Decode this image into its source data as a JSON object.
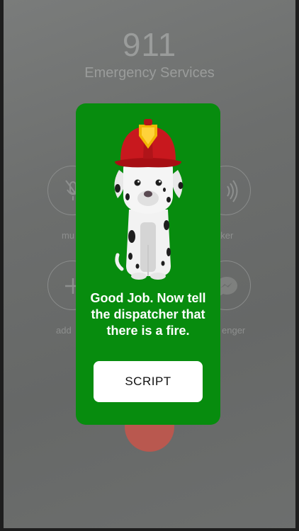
{
  "call": {
    "number": "911",
    "name": "Emergency Services",
    "buttons": {
      "mute": "mu",
      "speaker": "aker",
      "add": "add",
      "messenger": "enger"
    }
  },
  "modal": {
    "message": "Good Job. Now tell the dispatcher that there is a fire.",
    "script_label": "SCRIPT",
    "background": "#078c0e",
    "helmet_color": "#c8181e"
  }
}
